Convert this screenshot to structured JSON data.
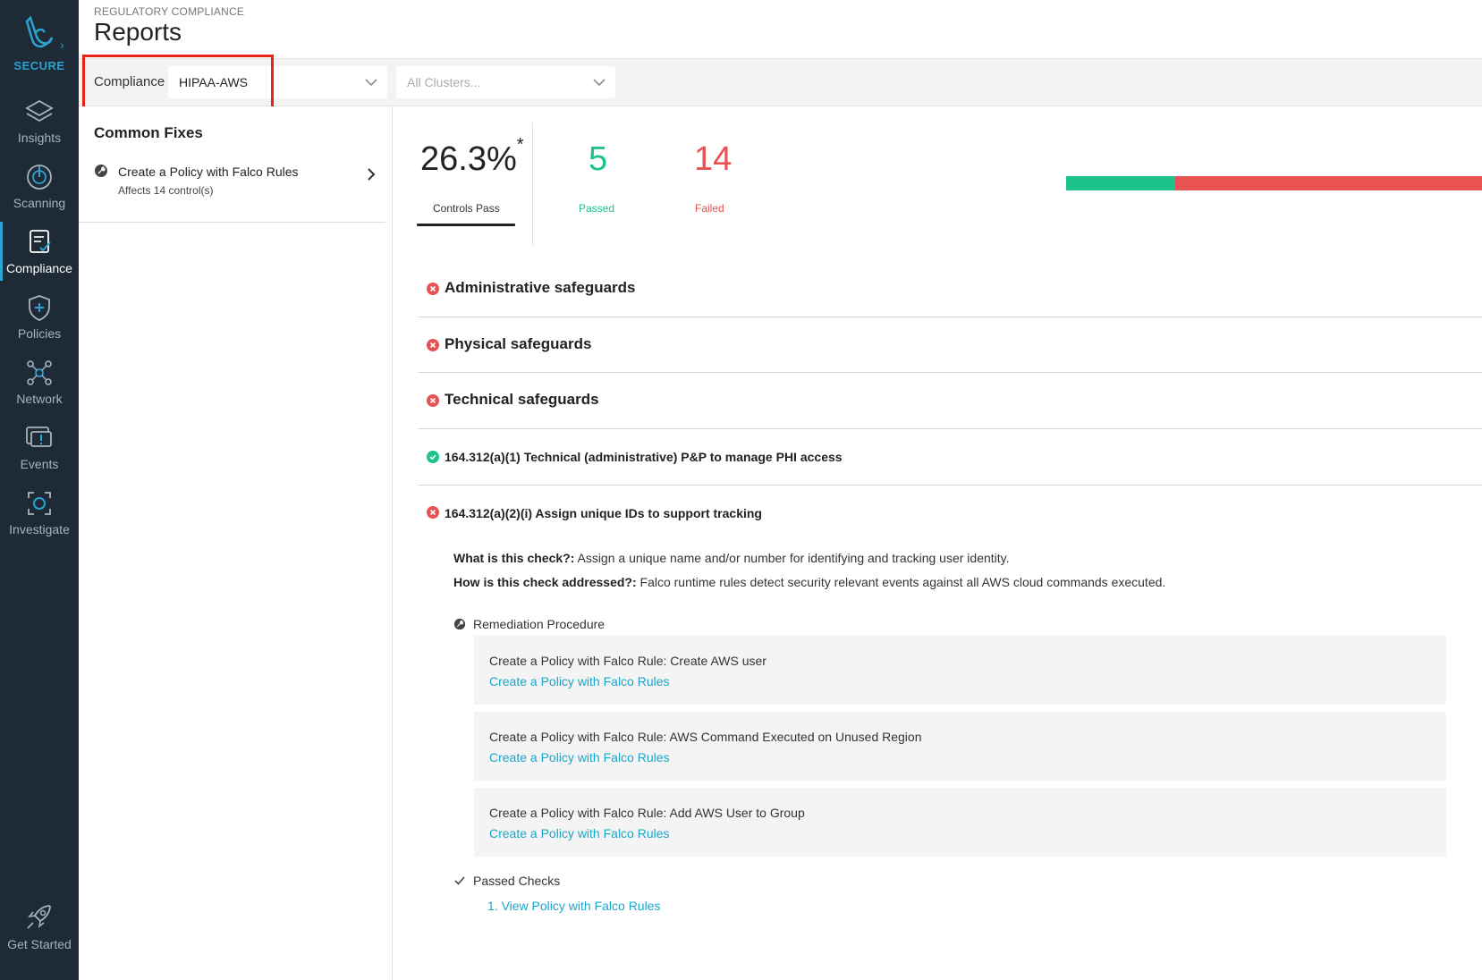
{
  "sidebar": {
    "brand": "SECURE",
    "items": [
      {
        "label": "Insights",
        "icon": "layers-icon"
      },
      {
        "label": "Scanning",
        "icon": "scanning-icon"
      },
      {
        "label": "Compliance",
        "icon": "compliance-icon",
        "active": true
      },
      {
        "label": "Policies",
        "icon": "shield-plus-icon"
      },
      {
        "label": "Network",
        "icon": "network-icon"
      },
      {
        "label": "Events",
        "icon": "events-icon"
      },
      {
        "label": "Investigate",
        "icon": "investigate-icon"
      }
    ],
    "get_started": "Get Started"
  },
  "header": {
    "breadcrumb": "REGULATORY COMPLIANCE",
    "title": "Reports"
  },
  "filters": {
    "label": "Compliance",
    "compliance_value": "HIPAA-AWS",
    "clusters_placeholder": "All Clusters..."
  },
  "common_fixes": {
    "title": "Common Fixes",
    "items": [
      {
        "title": "Create a Policy with Falco Rules",
        "subtitle": "Affects 14 control(s)"
      }
    ]
  },
  "stats": {
    "percent": "26.3%",
    "percent_mark": "*",
    "percent_label": "Controls Pass",
    "passed": "5",
    "passed_label": "Passed",
    "failed": "14",
    "failed_label": "Failed",
    "pass_fraction": 0.263,
    "colors": {
      "passed": "#1ec38b",
      "failed": "#e85252"
    }
  },
  "sections": [
    {
      "label": "Administrative safeguards",
      "status": "failed"
    },
    {
      "label": "Physical safeguards",
      "status": "failed"
    },
    {
      "label": "Technical safeguards",
      "status": "failed"
    },
    {
      "label": "164.312(a)(1) Technical (administrative) P&P to manage PHI access",
      "status": "passed"
    },
    {
      "label": "164.312(a)(2)(i) Assign unique IDs to support tracking",
      "status": "failed"
    }
  ],
  "detail": {
    "what_label": "What is this check?:",
    "what_text": "Assign a unique name and/or number for identifying and tracking user identity.",
    "how_label": "How is this check addressed?:",
    "how_text": "Falco runtime rules detect security relevant events against all AWS cloud commands executed.",
    "remediation_title": "Remediation Procedure",
    "remediations": [
      {
        "text": "Create a Policy with Falco Rule: Create AWS user",
        "link": "Create a Policy with Falco Rules"
      },
      {
        "text": "Create a Policy with Falco Rule: AWS Command Executed on Unused Region",
        "link": "Create a Policy with Falco Rules"
      },
      {
        "text": "Create a Policy with Falco Rule: Add AWS User to Group",
        "link": "Create a Policy with Falco Rules"
      }
    ],
    "passed_title": "Passed Checks",
    "passed_link": "1. View Policy with Falco Rules"
  }
}
